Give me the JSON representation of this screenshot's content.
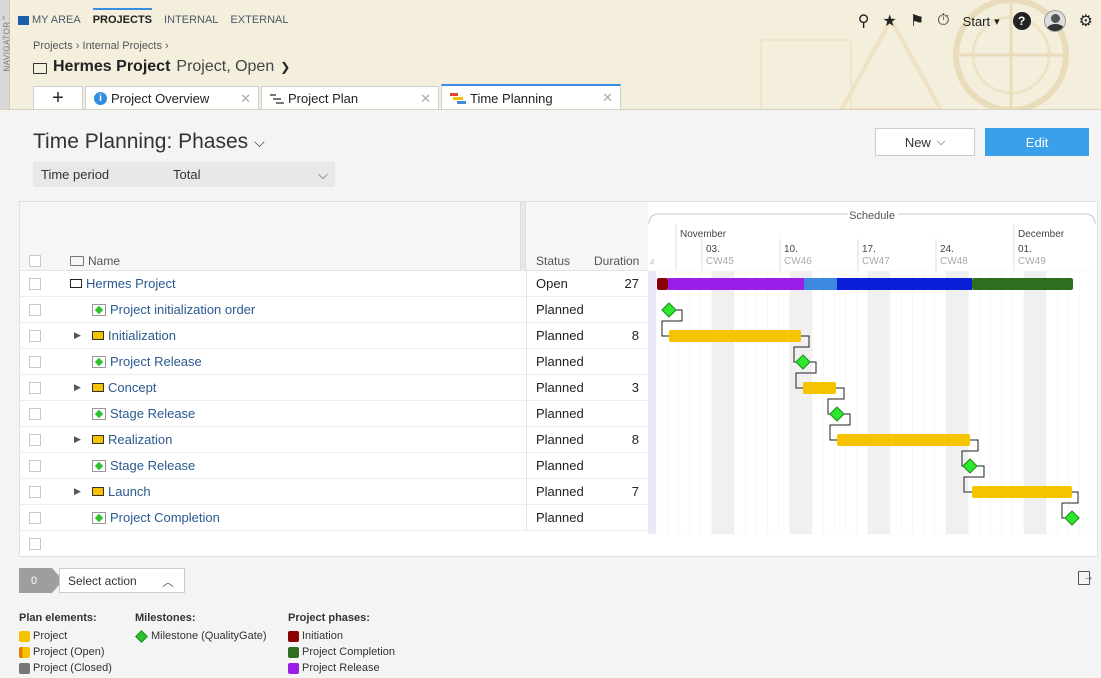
{
  "header": {
    "navigator_label": "NAVIGATOR",
    "nav_items": [
      "MY AREA",
      "PROJECTS",
      "INTERNAL",
      "EXTERNAL"
    ],
    "breadcrumb": "Projects › Internal Projects ›",
    "project_name": "Hermes Project",
    "project_meta": "Project, Open",
    "start_label": "Start",
    "tabs": [
      {
        "label": "Project Overview"
      },
      {
        "label": "Project Plan"
      },
      {
        "label": "Time Planning"
      }
    ]
  },
  "page": {
    "title": "Time Planning: Phases",
    "new_label": "New",
    "edit_label": "Edit",
    "filter_label": "Time period",
    "filter_value": "Total"
  },
  "table": {
    "col_name": "Name",
    "col_status": "Status",
    "col_duration": "Duration",
    "rows": [
      {
        "name": "Hermes Project",
        "status": "Open",
        "duration": "27",
        "type": "project"
      },
      {
        "name": "Project initialization order",
        "status": "Planned",
        "duration": "",
        "type": "milestone"
      },
      {
        "name": "Initialization",
        "status": "Planned",
        "duration": "8",
        "type": "phase"
      },
      {
        "name": "Project Release",
        "status": "Planned",
        "duration": "",
        "type": "milestone"
      },
      {
        "name": "Concept",
        "status": "Planned",
        "duration": "3",
        "type": "phase"
      },
      {
        "name": "Stage Release",
        "status": "Planned",
        "duration": "",
        "type": "milestone"
      },
      {
        "name": "Realization",
        "status": "Planned",
        "duration": "8",
        "type": "phase"
      },
      {
        "name": "Stage Release",
        "status": "Planned",
        "duration": "",
        "type": "milestone"
      },
      {
        "name": "Launch",
        "status": "Planned",
        "duration": "7",
        "type": "phase"
      },
      {
        "name": "Project Completion",
        "status": "Planned",
        "duration": "",
        "type": "milestone"
      }
    ]
  },
  "schedule": {
    "title": "Schedule",
    "months": [
      "November",
      "December"
    ],
    "weeks": [
      {
        "day": "03.",
        "cw": "CW45"
      },
      {
        "day": "10.",
        "cw": "CW46"
      },
      {
        "day": "17.",
        "cw": "CW47"
      },
      {
        "day": "24.",
        "cw": "CW48"
      },
      {
        "day": "01.",
        "cw": "CW49"
      }
    ],
    "first_col_label": "4",
    "colors": {
      "initiation": "#8b0000",
      "release": "#9b1ee8",
      "blue_light": "#3d87e0",
      "blue_dark": "#0a1ed8",
      "completion": "#2e6e1e",
      "bar": "#f5c300",
      "milestone": "#2ee62e"
    }
  },
  "footer": {
    "selected_count": "0",
    "select_action": "Select action"
  },
  "legend": {
    "plan_title": "Plan elements:",
    "plan_items": [
      "Project",
      "Project (Open)",
      "Project (Closed)"
    ],
    "milestone_title": "Milestones:",
    "milestone_items": [
      "Milestone (QualityGate)"
    ],
    "phase_title": "Project phases:",
    "phase_items": [
      "Initiation",
      "Project Completion",
      "Project Release"
    ]
  }
}
